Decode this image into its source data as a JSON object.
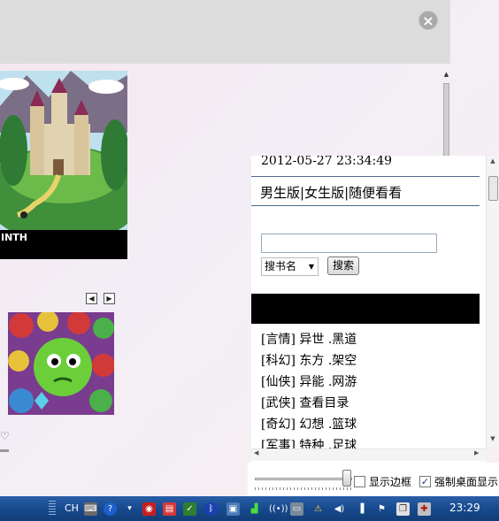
{
  "overlay": {
    "close_glyph": "×"
  },
  "background_page": {
    "game1_caption": "INTH",
    "pager_prev": "◀",
    "pager_next": "▶",
    "heart_icon": "heart-icon"
  },
  "panel": {
    "datetime": "2012-05-27 23:34:49",
    "tabs": [
      "男生版",
      "女生版",
      "随便看看"
    ],
    "tab_separator": "|",
    "search": {
      "value": "",
      "placeholder": ""
    },
    "select_value": "搜书名",
    "search_button": "搜索",
    "categories": [
      {
        "tag": "[言情]",
        "items": [
          "异世",
          ".黑道"
        ]
      },
      {
        "tag": "[科幻]",
        "items": [
          "东方",
          ".架空"
        ]
      },
      {
        "tag": "[仙侠]",
        "items": [
          "异能",
          ".网游"
        ]
      },
      {
        "tag": "[武侠]",
        "items": [
          "查看目录"
        ]
      },
      {
        "tag": "[奇幻]",
        "items": [
          "幻想",
          ".篮球"
        ]
      },
      {
        "tag": "[军事]",
        "items": [
          "特种",
          ".足球"
        ]
      }
    ]
  },
  "controls": {
    "show_border_label": "显示边框",
    "show_border_checked": false,
    "force_desktop_label": "强制桌面显示",
    "force_desktop_checked": true,
    "check_mark": "✓",
    "opacity_slider_level": 0.95
  },
  "taskbar": {
    "ime_label": "CH",
    "clock": "23:29",
    "tray_icons": [
      "keyboard-icon",
      "help-icon",
      "arrow-icon",
      "app-red-icon",
      "app-red2-icon",
      "shield-icon",
      "bluetooth-icon",
      "display-icon",
      "signal-icon",
      "wifi-icon",
      "network-icon",
      "drive-icon",
      "warning-icon",
      "volume-icon",
      "battery-icon",
      "flag-icon",
      "copy-icon",
      "security-icon"
    ],
    "colors": {
      "taskbar": "#174a8d",
      "accent": "#2a5fa8"
    }
  }
}
